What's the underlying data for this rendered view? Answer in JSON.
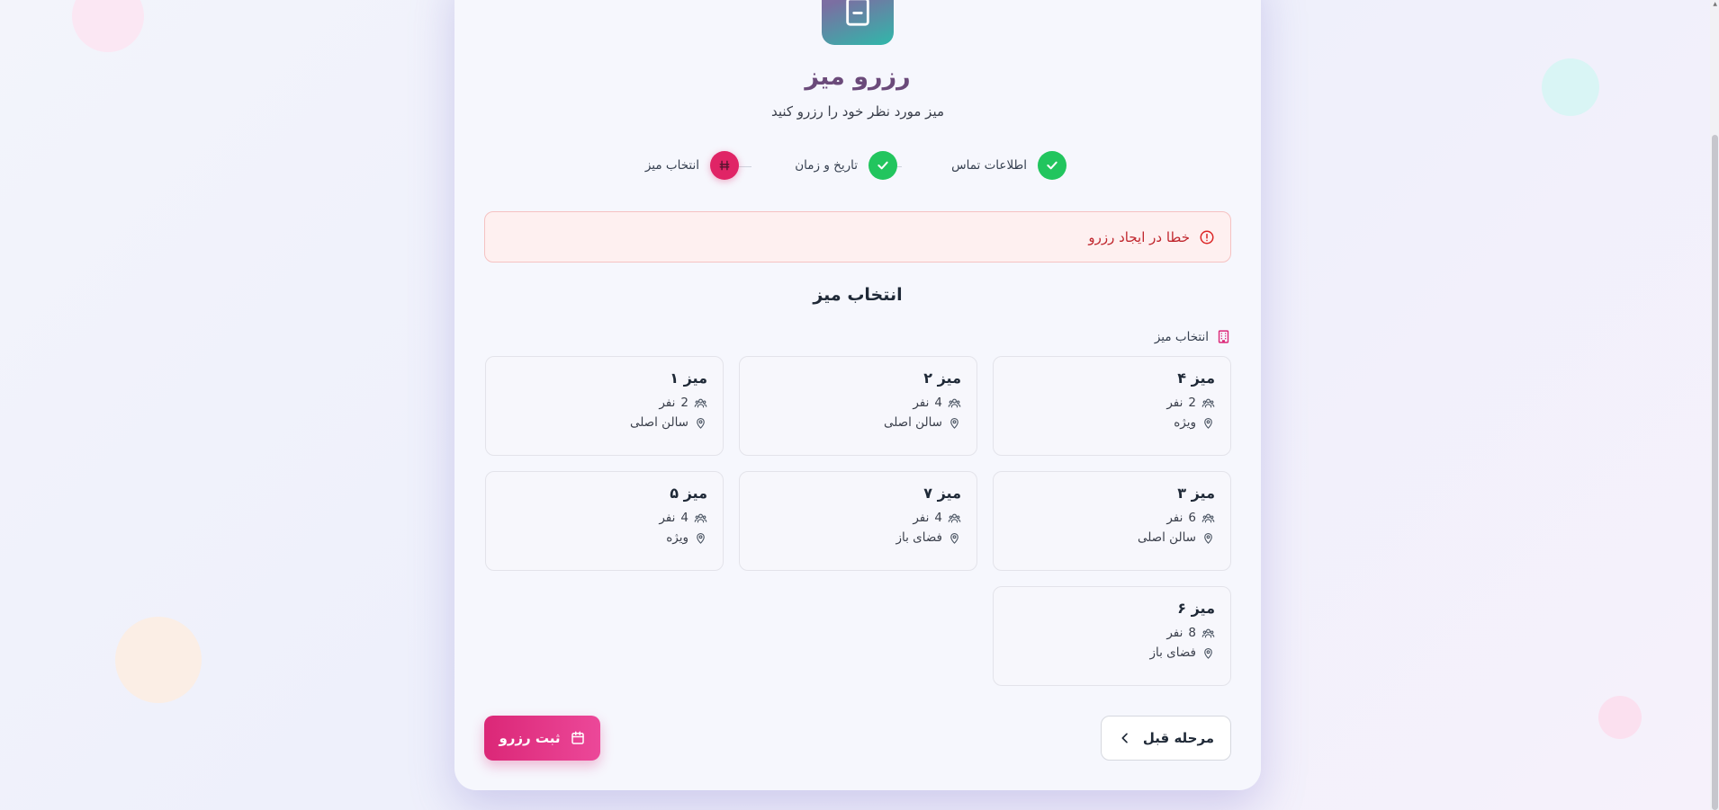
{
  "header": {
    "title": "رزرو میز",
    "subtitle": "میز مورد نظر خود را رزرو کنید"
  },
  "stepper": [
    {
      "label": "اطلاعات تماس",
      "status": "done"
    },
    {
      "label": "تاریخ و زمان",
      "status": "done"
    },
    {
      "label": "انتخاب میز",
      "status": "active"
    }
  ],
  "error": {
    "message": "خطا در ایجاد رزرو"
  },
  "section": {
    "title": "انتخاب میز",
    "field_label": "انتخاب میز"
  },
  "tables": [
    {
      "name": "میز ۴",
      "capacity_num": "2",
      "capacity_unit": "نفر",
      "location": "ویژه"
    },
    {
      "name": "میز ۲",
      "capacity_num": "4",
      "capacity_unit": "نفر",
      "location": "سالن اصلی"
    },
    {
      "name": "میز ۱",
      "capacity_num": "2",
      "capacity_unit": "نفر",
      "location": "سالن اصلی"
    },
    {
      "name": "میز ۳",
      "capacity_num": "6",
      "capacity_unit": "نفر",
      "location": "سالن اصلی"
    },
    {
      "name": "میز ۷",
      "capacity_num": "4",
      "capacity_unit": "نفر",
      "location": "فضای باز"
    },
    {
      "name": "میز ۵",
      "capacity_num": "4",
      "capacity_unit": "نفر",
      "location": "ویژه"
    },
    {
      "name": "میز ۶",
      "capacity_num": "8",
      "capacity_unit": "نفر",
      "location": "فضای باز"
    }
  ],
  "actions": {
    "prev_label": "مرحله قبل",
    "submit_label": "ثبت رزرو"
  },
  "colors": {
    "accent": "#e02466",
    "success": "#22c55e",
    "error": "#c0262d",
    "title": "#6b4a7a"
  }
}
